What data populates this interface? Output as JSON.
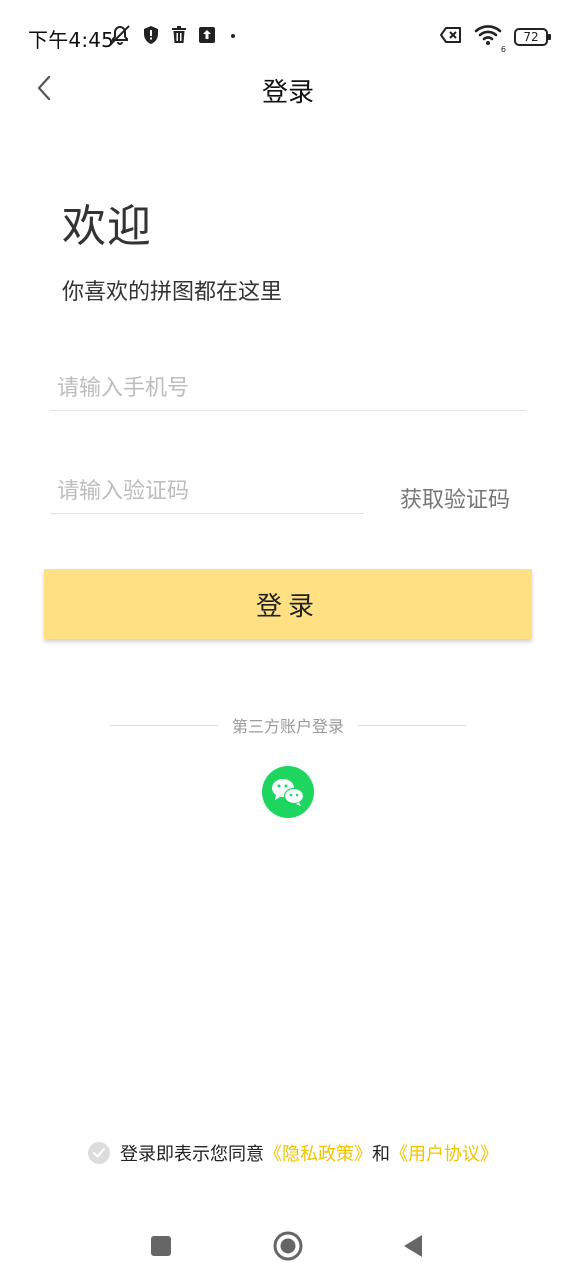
{
  "status_bar": {
    "time": "下午4:45",
    "battery": "72",
    "network": "6"
  },
  "header": {
    "title": "登录"
  },
  "welcome": {
    "title": "欢迎",
    "subtitle": "你喜欢的拼图都在这里"
  },
  "form": {
    "phone_placeholder": "请输入手机号",
    "phone_value": "",
    "code_placeholder": "请输入验证码",
    "code_value": "",
    "get_code_label": "获取验证码",
    "login_label": "登录"
  },
  "third_party": {
    "label": "第三方账户登录"
  },
  "agreement": {
    "prefix": "登录即表示您同意",
    "privacy_link": "《隐私政策》",
    "and": "和",
    "terms_link": "《用户协议》"
  },
  "colors": {
    "accent": "#ffe082",
    "link": "#f2c400",
    "wechat": "#1ed65f"
  }
}
